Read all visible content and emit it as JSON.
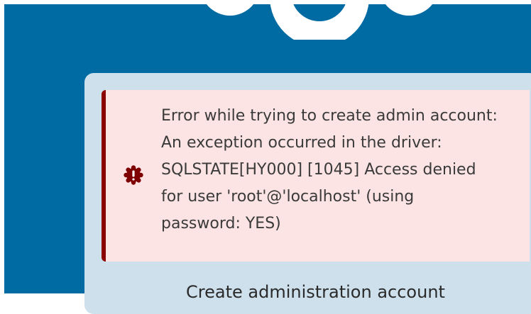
{
  "error": {
    "message": "Error while trying to create admin account:\nAn exception occurred in the driver:\nSQLSTATE[HY000] [1045] Access denied\nfor user 'root'@'localhost' (using\npassword: YES)",
    "icon": "error-icon"
  },
  "panel": {
    "heading": "Create administration account"
  },
  "colors": {
    "background": "#006aa3",
    "panel": "#cde0ec",
    "error_background": "#fde4e4",
    "error_border": "#8b0000",
    "error_icon": "#7f0000"
  }
}
